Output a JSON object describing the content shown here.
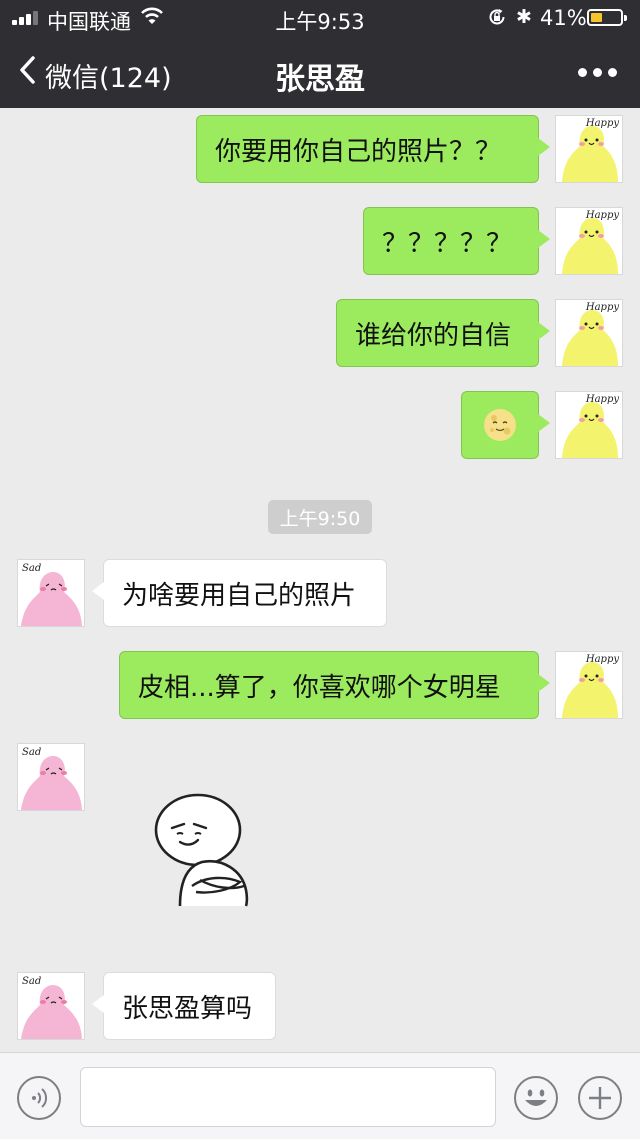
{
  "status_bar": {
    "carrier": "中国联通",
    "time": "上午9:53",
    "battery_percent": "41%",
    "battery_level": 0.41,
    "icons": [
      "signal-icon",
      "wifi-icon",
      "orientation-lock-icon",
      "bluetooth-icon",
      "battery-icon"
    ]
  },
  "nav": {
    "back_label": "微信(124)",
    "title": "张思盈",
    "more_icon": "more-dots-icon"
  },
  "avatars": {
    "self_tag": "Happy",
    "contact_tag": "Sad"
  },
  "messages": [
    {
      "side": "out",
      "text": "你要用你自己的照片？？"
    },
    {
      "side": "out",
      "text": "？？？？？"
    },
    {
      "side": "out",
      "text": "谁给你的自信"
    },
    {
      "side": "out",
      "emoji": "moon-face-emoji"
    },
    {
      "timestamp": "上午9:50"
    },
    {
      "side": "in",
      "text": "为啥要用自己的照片"
    },
    {
      "side": "out",
      "text": "皮相...算了，你喜欢哪个女明星"
    },
    {
      "side": "in",
      "sticker": "arms-crossed-smirk-sticker"
    },
    {
      "side": "in",
      "text": "张思盈算吗"
    }
  ],
  "input_bar": {
    "voice_icon": "voice-icon",
    "text_value": "",
    "emoji_icon": "emoji-icon",
    "plus_icon": "plus-icon"
  },
  "colors": {
    "nav_bg": "#2e2e33",
    "chat_bg": "#ebebeb",
    "outgoing_bubble": "#9ceb5f",
    "incoming_bubble": "#ffffff",
    "timestamp_bg": "#cecece",
    "self_avatar": "#f3f36d",
    "contact_avatar": "#f5b6d6"
  }
}
